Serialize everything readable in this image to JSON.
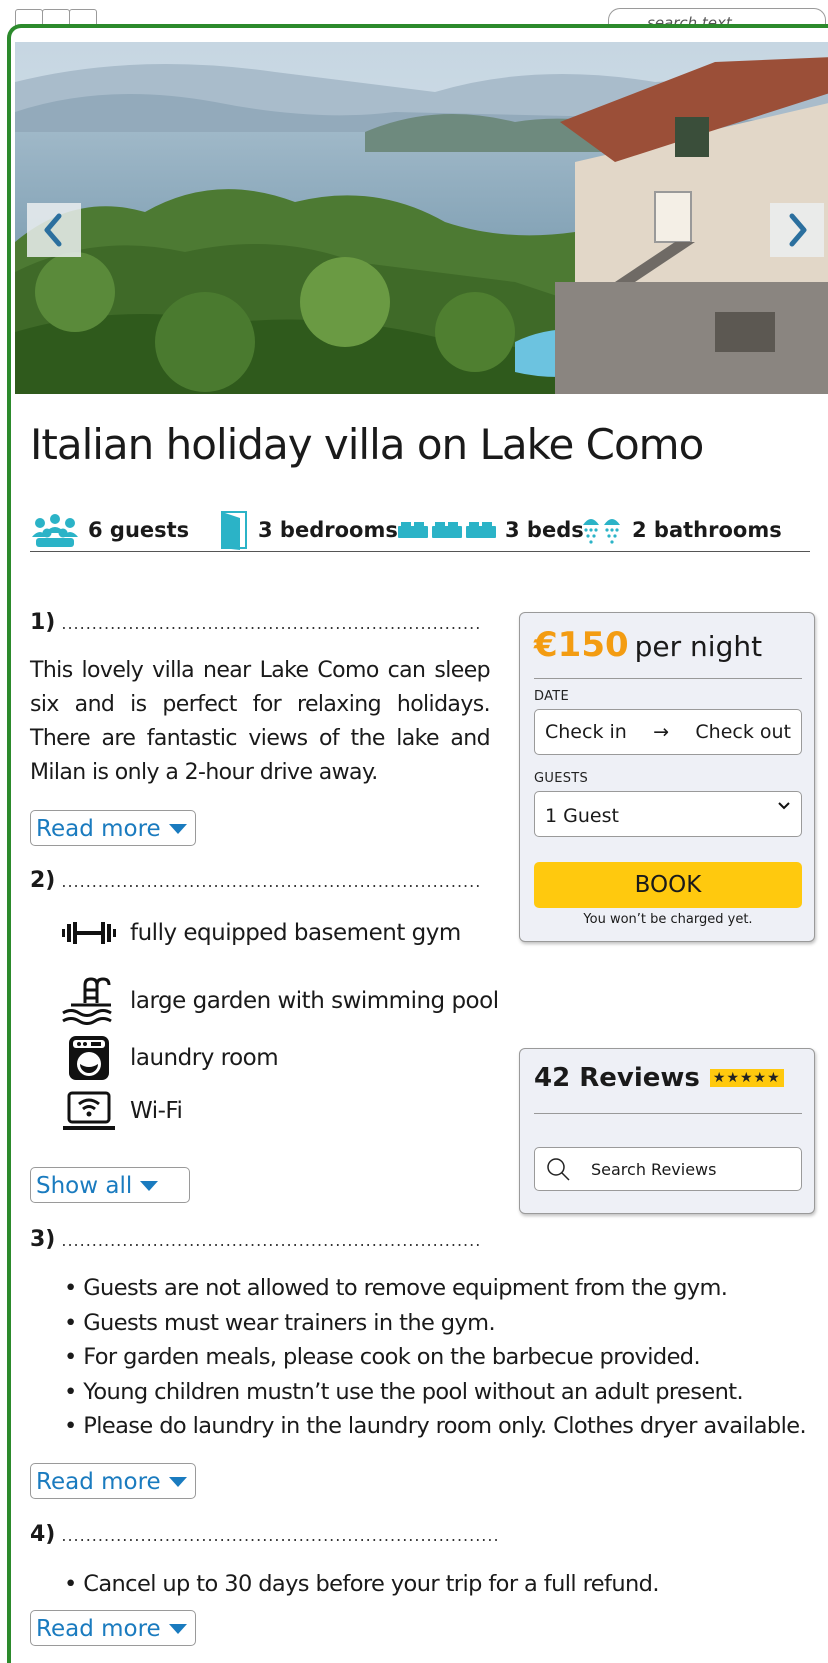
{
  "search": {
    "placeholder": "search text..."
  },
  "listing": {
    "title": "Italian holiday villa on Lake Como",
    "features": [
      {
        "icon": "guests-icon",
        "label": "6 guests"
      },
      {
        "icon": "door-icon",
        "label": "3 bedrooms"
      },
      {
        "icon": "bed-icon",
        "label": "3 beds"
      },
      {
        "icon": "shower-icon",
        "label": "2 bathrooms"
      }
    ]
  },
  "sections": [
    {
      "number": "1)",
      "dots": "....................................................................."
    },
    {
      "number": "2)",
      "dots": "....................................................................."
    },
    {
      "number": "3)",
      "dots": "....................................................................."
    },
    {
      "number": "4)",
      "dots": "........................................................................"
    }
  ],
  "description": "This lovely villa near Lake Como can sleep six and is perfect for relaxing holidays. There are fantastic views of the lake and Milan is only a 2-hour drive away.",
  "amenities": [
    {
      "icon": "dumbbell-icon",
      "label": "fully equipped basement gym"
    },
    {
      "icon": "pool-icon",
      "label": "large garden with swimming pool"
    },
    {
      "icon": "washing-machine-icon",
      "label": "laundry room"
    },
    {
      "icon": "wifi-icon",
      "label": "Wi-Fi"
    }
  ],
  "rules": [
    "• Guests are not allowed to remove equipment from the gym.",
    "• Guests must wear trainers in the gym.",
    "• For garden meals, please cook on the barbecue provided.",
    "• Young children mustn’t use the pool without an adult present.",
    "• Please do laundry in the laundry room only. Clothes dryer available."
  ],
  "cancellation": [
    "• Cancel up to 30 days before your trip for a full refund."
  ],
  "buttons": {
    "read_more": "Read more",
    "show_all": "Show all"
  },
  "booking": {
    "price": "€150",
    "unit": "per night",
    "date_label": "DATE",
    "check_in": "Check in",
    "arrow": "→",
    "check_out": "Check out",
    "guests_label": "GUESTS",
    "guests_value": "1 Guest",
    "book_label": "BOOK",
    "note": "You won’t be charged yet."
  },
  "reviews": {
    "title": "42 Reviews",
    "stars": "★★★★★",
    "rating": 5,
    "search_label": "Search Reviews"
  },
  "colors": {
    "frame": "#2c8a2c",
    "accent_blue": "#1a7bbf",
    "price_orange": "#f39c12",
    "book_yellow": "#ffc90e",
    "icon_teal": "#2bb3c7"
  }
}
